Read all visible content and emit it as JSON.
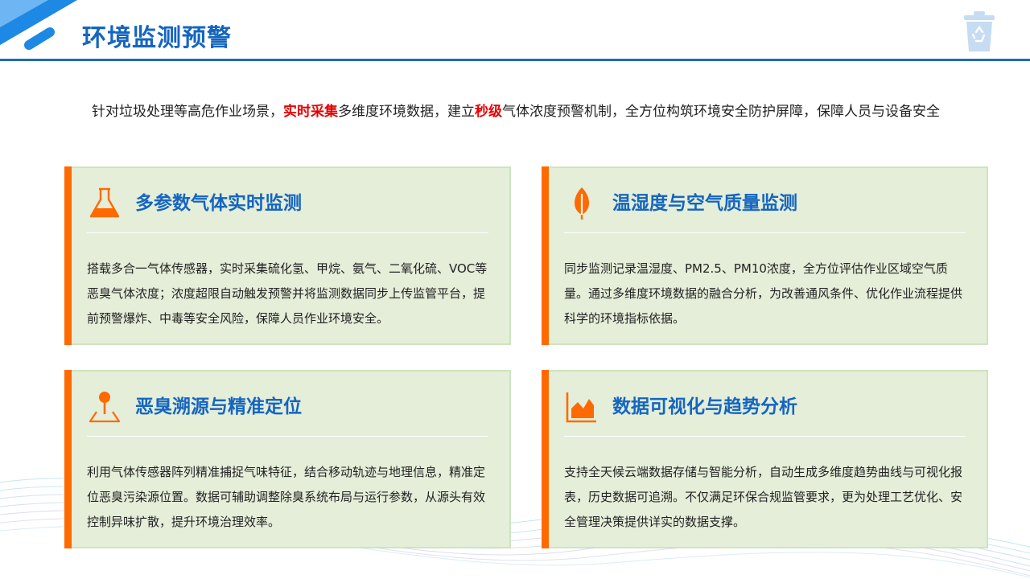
{
  "header": {
    "title": "环境监测预警"
  },
  "intro": {
    "part1": "针对垃圾处理等高危作业场景，",
    "highlight1": "实时采集",
    "part2": "多维度环境数据，建立",
    "highlight2": "秒级",
    "part3": "气体浓度预警机制，全方位构筑环境安全防护屏障，保障人员与设备安全"
  },
  "colors": {
    "accent": "#ff6a00",
    "title_blue": "#1565c0",
    "highlight_red": "#e60000",
    "card_bg": "#e4eed9"
  },
  "cards": [
    {
      "icon": "flask-icon",
      "title": "多参数气体实时监测",
      "body": "搭载多合一气体传感器，实时采集硫化氢、甲烷、氨气、二氧化硫、VOC等恶臭气体浓度；浓度超限自动触发预警并将监测数据同步上传监管平台，提前预警爆炸、中毒等安全风险，保障人员作业环境安全。"
    },
    {
      "icon": "leaf-icon",
      "title": "温湿度与空气质量监测",
      "body": "同步监测记录温湿度、PM2.5、PM10浓度，全方位评估作业区域空气质量。通过多维度环境数据的融合分析，为改善通风条件、优化作业流程提供科学的环境指标依据。"
    },
    {
      "icon": "location-pin-icon",
      "title": "恶臭溯源与精准定位",
      "body": "利用气体传感器阵列精准捕捉气味特征，结合移动轨迹与地理信息，精准定位恶臭污染源位置。数据可辅助调整除臭系统布局与运行参数，从源头有效控制异味扩散，提升环境治理效率。"
    },
    {
      "icon": "area-chart-icon",
      "title": "数据可视化与趋势分析",
      "body": "支持全天候云端数据存储与智能分析，自动生成多维度趋势曲线与可视化报表，历史数据可追溯。不仅满足环保合规监管要求，更为处理工艺优化、安全管理决策提供详实的数据支撑。"
    }
  ]
}
